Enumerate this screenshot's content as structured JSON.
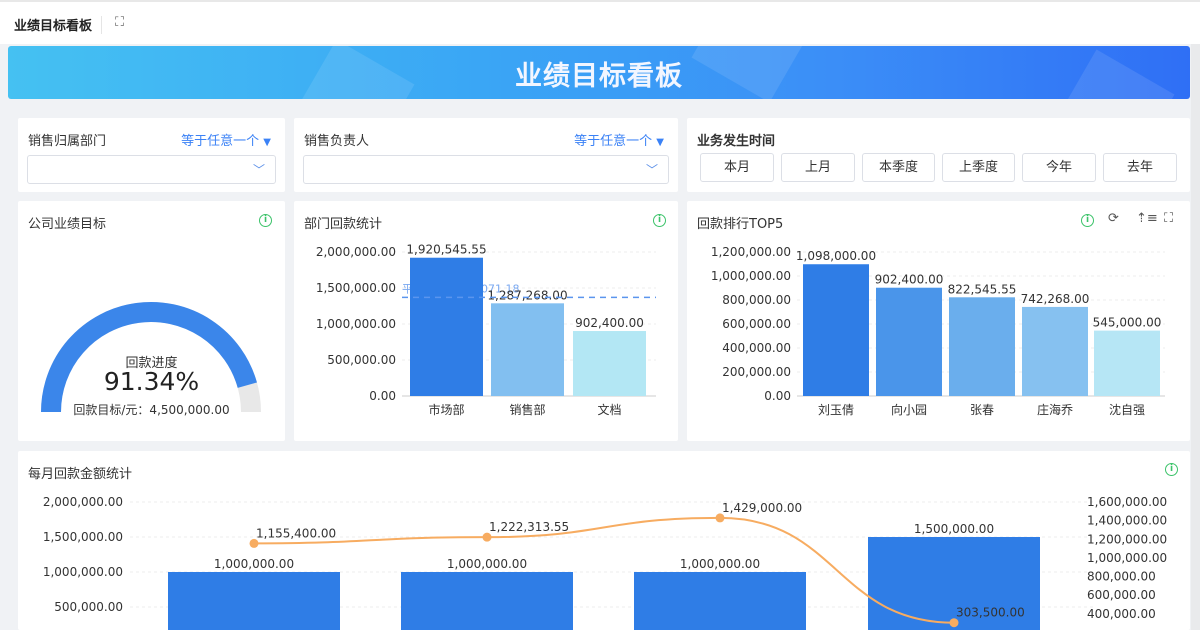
{
  "header": {
    "title": "业绩目标看板",
    "fullscreen_icon": "expand-icon"
  },
  "banner": {
    "title": "业绩目标看板"
  },
  "filters": {
    "dept": {
      "label": "销售归属部门",
      "operator": "等于任意一个",
      "value": ""
    },
    "owner": {
      "label": "销售负责人",
      "operator": "等于任意一个",
      "value": ""
    },
    "time": {
      "label": "业务发生时间",
      "options": [
        "本月",
        "上月",
        "本季度",
        "上季度",
        "今年",
        "去年"
      ]
    }
  },
  "gauge": {
    "title": "公司业绩目标",
    "label": "回款进度",
    "percent_text": "91.34%",
    "progress": 0.9134,
    "target_text": "回款目标/元：4,500,000.00",
    "colors": {
      "fill": "#3b86ea",
      "track": "#e8e8e8"
    }
  },
  "chart_data": [
    {
      "id": "dept",
      "type": "bar",
      "title": "部门回款统计",
      "categories": [
        "市场部",
        "销售部",
        "文档"
      ],
      "values": [
        1920545.55,
        1287268.0,
        902400.0
      ],
      "labels": [
        "1,920,545.55",
        "1,287,268.00",
        "902,400.00"
      ],
      "colors": [
        "#2f7de6",
        "#82bff0",
        "#b3e7f4"
      ],
      "ylim": [
        0,
        2000000
      ],
      "yticks": [
        "0.00",
        "500,000.00",
        "1,000,000.00",
        "1,500,000.00",
        "2,000,000.00"
      ],
      "average": {
        "value": 1370071.18,
        "label": "平均值：1,370,071.18"
      },
      "grid": true
    },
    {
      "id": "top5",
      "type": "bar",
      "title": "回款排行TOP5",
      "categories": [
        "刘玉倩",
        "向小园",
        "张春",
        "庄海乔",
        "沈自强"
      ],
      "values": [
        1098000,
        902400,
        822545.55,
        742268,
        545000
      ],
      "labels": [
        "1,098,000.00",
        "902,400.00",
        "822,545.55",
        "742,268.00",
        "545,000.00"
      ],
      "colors": [
        "#2f7de6",
        "#4a95ea",
        "#6aaeed",
        "#86c1f0",
        "#b6e6f5"
      ],
      "ylim": [
        0,
        1200000
      ],
      "yticks": [
        "0.00",
        "200,000.00",
        "400,000.00",
        "600,000.00",
        "800,000.00",
        "1,000,000.00",
        "1,200,000.00"
      ],
      "grid": true
    },
    {
      "id": "monthly",
      "type": "bar+line",
      "title": "每月回款金额统计",
      "bars": {
        "values": [
          1000000,
          1000000,
          1000000,
          1500000
        ],
        "labels": [
          "1,000,000.00",
          "1,000,000.00",
          "1,000,000.00",
          "1,500,000.00"
        ],
        "color": "#2f7de6"
      },
      "line": {
        "values": [
          1155400,
          1222313.55,
          1429000,
          303500
        ],
        "labels": [
          "1,155,400.00",
          "1,222,313.55",
          "1,429,000.00",
          "303,500.00"
        ],
        "color": "#f7ac61"
      },
      "ylim_left": [
        0,
        2000000
      ],
      "ylim_right": [
        0,
        1600000
      ],
      "yticks_left": [
        "500,000.00",
        "1,000,000.00",
        "1,500,000.00",
        "2,000,000.00"
      ],
      "yticks_right": [
        "400,000.00",
        "600,000.00",
        "800,000.00",
        "1,000,000.00",
        "1,200,000.00",
        "1,400,000.00",
        "1,600,000.00"
      ],
      "grid": true
    }
  ]
}
